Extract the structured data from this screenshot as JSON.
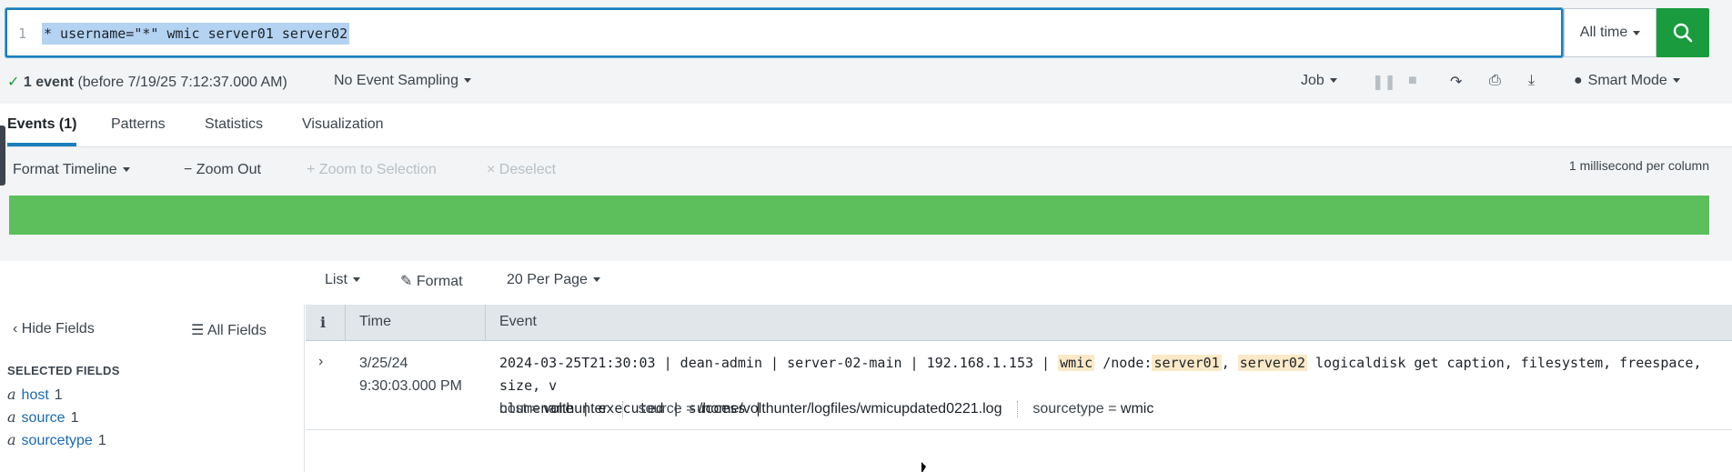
{
  "search": {
    "line_number": "1",
    "query": "* username=\"*\" wmic server01 server02",
    "time_range": "All time"
  },
  "status": {
    "event_count": "1 event",
    "before": "(before 7/19/25 7:12:37.000 AM)",
    "sampling": "No Event Sampling",
    "job": "Job",
    "mode": "Smart Mode"
  },
  "tabs": [
    {
      "label": "Events (1)"
    },
    {
      "label": "Patterns"
    },
    {
      "label": "Statistics"
    },
    {
      "label": "Visualization"
    }
  ],
  "timeline": {
    "format": "Format Timeline",
    "zoom_out": "Zoom Out",
    "zoom_selection": "Zoom to Selection",
    "deselect": "Deselect",
    "scale": "1 millisecond per column",
    "bar_color": "#5cbf5c"
  },
  "results_toolbar": {
    "list": "List",
    "format": "Format",
    "per_page": "20 Per Page"
  },
  "sidebar": {
    "hide_fields": "Hide Fields",
    "all_fields": "All Fields",
    "selected_title": "SELECTED FIELDS",
    "fields": [
      {
        "type": "a",
        "name": "host",
        "count": "1"
      },
      {
        "type": "a",
        "name": "source",
        "count": "1"
      },
      {
        "type": "a",
        "name": "sourcetype",
        "count": "1"
      }
    ]
  },
  "table": {
    "col_info": "i",
    "col_time": "Time",
    "col_event": "Event",
    "rows": [
      {
        "date": "3/25/24",
        "time": "9:30:03.000 PM",
        "event_parts": {
          "p1": "2024-03-25T21:30:03 | dean-admin | server-02-main | 192.168.1.153 | ",
          "h1": "wmic",
          "p2": " /node:",
          "h2": "server01",
          "p3": ", ",
          "h3": "server02",
          "p4": " logicaldisk get caption, filesystem, freespace, size, v",
          "p5": "olumename | executed | success |"
        },
        "host_key": "host =",
        "host_val": "volthunter",
        "source_key": "source =",
        "source_val": "/home/volthunter/logfiles/wmicupdated0221.log",
        "sourcetype_key": "sourcetype =",
        "sourcetype_val": "wmic"
      }
    ]
  },
  "colors": {
    "accent": "#1a7fbd",
    "search_button": "#1a9c3e",
    "highlight": "#fbe9c7"
  }
}
